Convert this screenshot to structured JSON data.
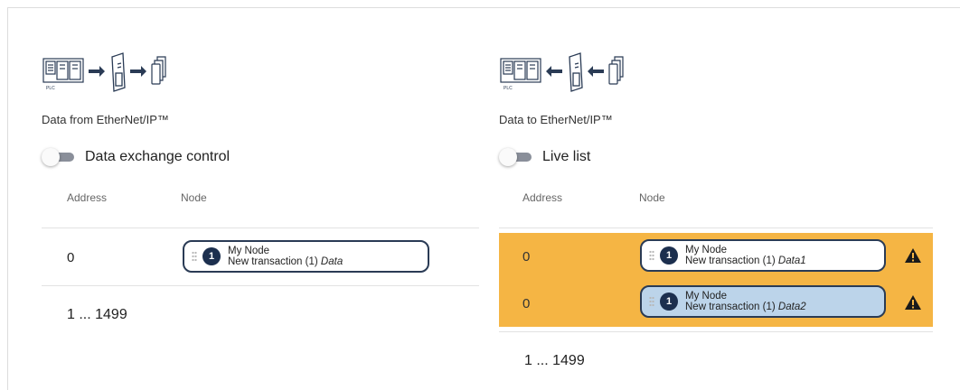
{
  "left": {
    "diagram_icon": "plc-to-gateway-to-devices-icon",
    "title": "Data from EtherNet/IP™",
    "toggle_label": "Data exchange control",
    "col_address": "Address",
    "col_node": "Node",
    "rows": [
      {
        "address": "0",
        "node_name": "My Node",
        "transaction": "New transaction (1)",
        "data": "Data",
        "badge": "1"
      }
    ],
    "range": "1 ... 1499"
  },
  "right": {
    "diagram_icon": "devices-to-gateway-to-plc-icon",
    "title": "Data to EtherNet/IP™",
    "toggle_label": "Live list",
    "col_address": "Address",
    "col_node": "Node",
    "rows": [
      {
        "address": "0",
        "node_name": "My Node",
        "transaction": "New transaction (1)",
        "data": "Data1",
        "badge": "1",
        "warning": true
      },
      {
        "address": "0",
        "node_name": "My Node",
        "transaction": "New transaction (1)",
        "data": "Data2",
        "badge": "1",
        "warning": true,
        "selected": true
      }
    ],
    "range": "1 ... 1499"
  },
  "icons": {
    "plc_label": "PLC"
  },
  "colors": {
    "warning_row": "#f5b544",
    "chip_border": "#2a3b55",
    "badge": "#1c2f4e",
    "selected_chip": "#bcd4ea"
  }
}
